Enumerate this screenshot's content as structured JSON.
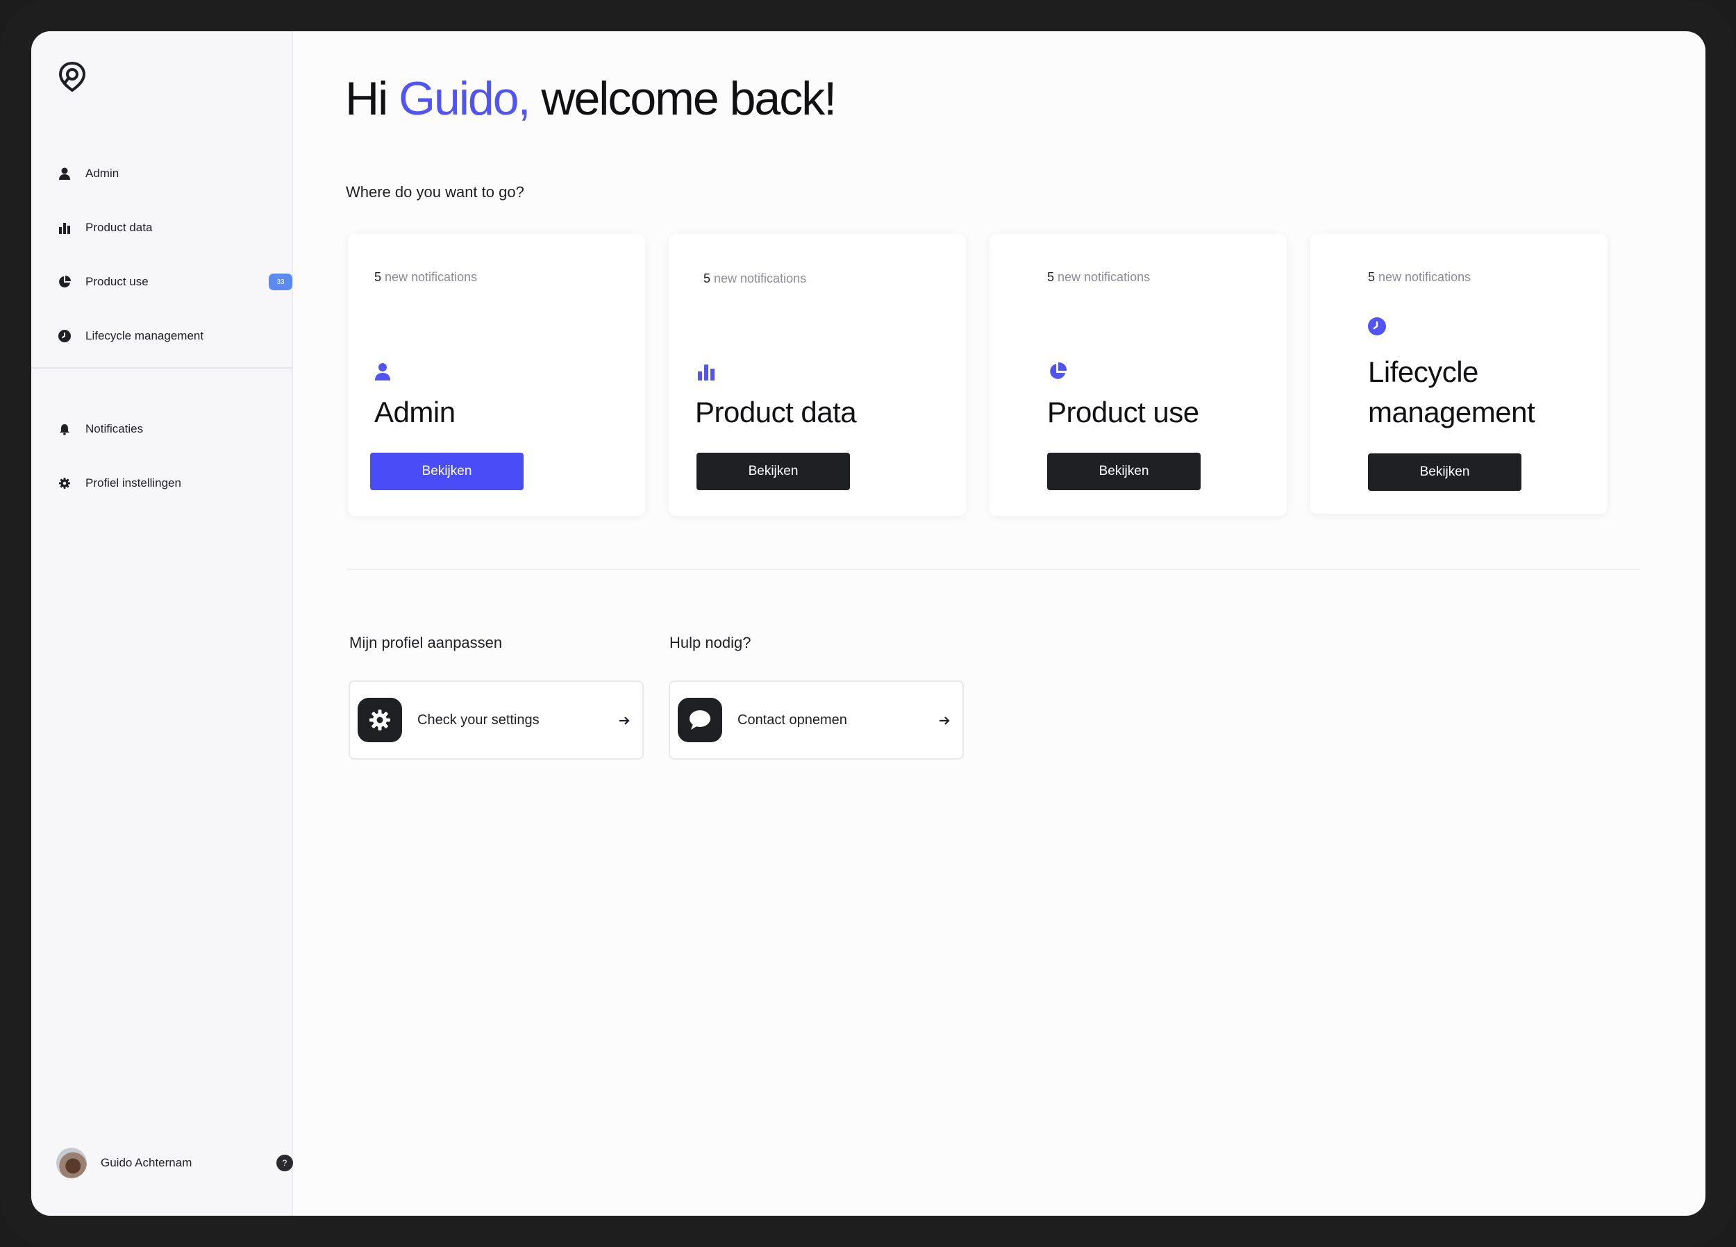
{
  "sidebar": {
    "logo_icon": "location-pin-logo",
    "nav": [
      {
        "label": "Admin",
        "icon": "user-icon"
      },
      {
        "label": "Product data",
        "icon": "bar-chart-icon"
      },
      {
        "label": "Product use",
        "icon": "pie-chart-icon",
        "badge": "33"
      },
      {
        "label": "Lifecycle management",
        "icon": "clock-icon"
      }
    ],
    "secondary_nav": [
      {
        "label": "Notificaties",
        "icon": "bell-icon"
      },
      {
        "label": "Profiel instellingen",
        "icon": "gear-icon"
      }
    ],
    "user": {
      "name": "Guido Achternam",
      "help": "?"
    }
  },
  "greeting": {
    "prefix": "Hi ",
    "name": "Guido,",
    "suffix": " welcome back!"
  },
  "destinations": {
    "title": "Where do you want to go?",
    "cards": [
      {
        "count": "5",
        "notif_text": " new notifications",
        "title": "Admin",
        "button": "Bekijken",
        "icon": "user-icon"
      },
      {
        "count": "5",
        "notif_text": " new notifications",
        "title": "Product data",
        "button": "Bekijken",
        "icon": "bar-chart-icon"
      },
      {
        "count": "5",
        "notif_text": " new notifications",
        "title": "Product use",
        "button": "Bekijken",
        "icon": "pie-chart-icon"
      },
      {
        "count": "5",
        "notif_text": " new notifications",
        "title_line1": "Lifecycle",
        "title_line2": "management",
        "button": "Bekijken",
        "icon": "clock-icon"
      }
    ]
  },
  "profile_section": {
    "title": "Mijn profiel aanpassen",
    "link": {
      "label": "Check your settings",
      "icon": "gear-icon"
    }
  },
  "help_section": {
    "title": "Hulp nodig?",
    "link": {
      "label": "Contact opnemen",
      "icon": "chat-bubble-icon"
    }
  },
  "colors": {
    "accent": "#5154f0",
    "primary_button": "#4a4cf5",
    "dark_button": "#1f2024",
    "badge": "#5b8af5"
  }
}
